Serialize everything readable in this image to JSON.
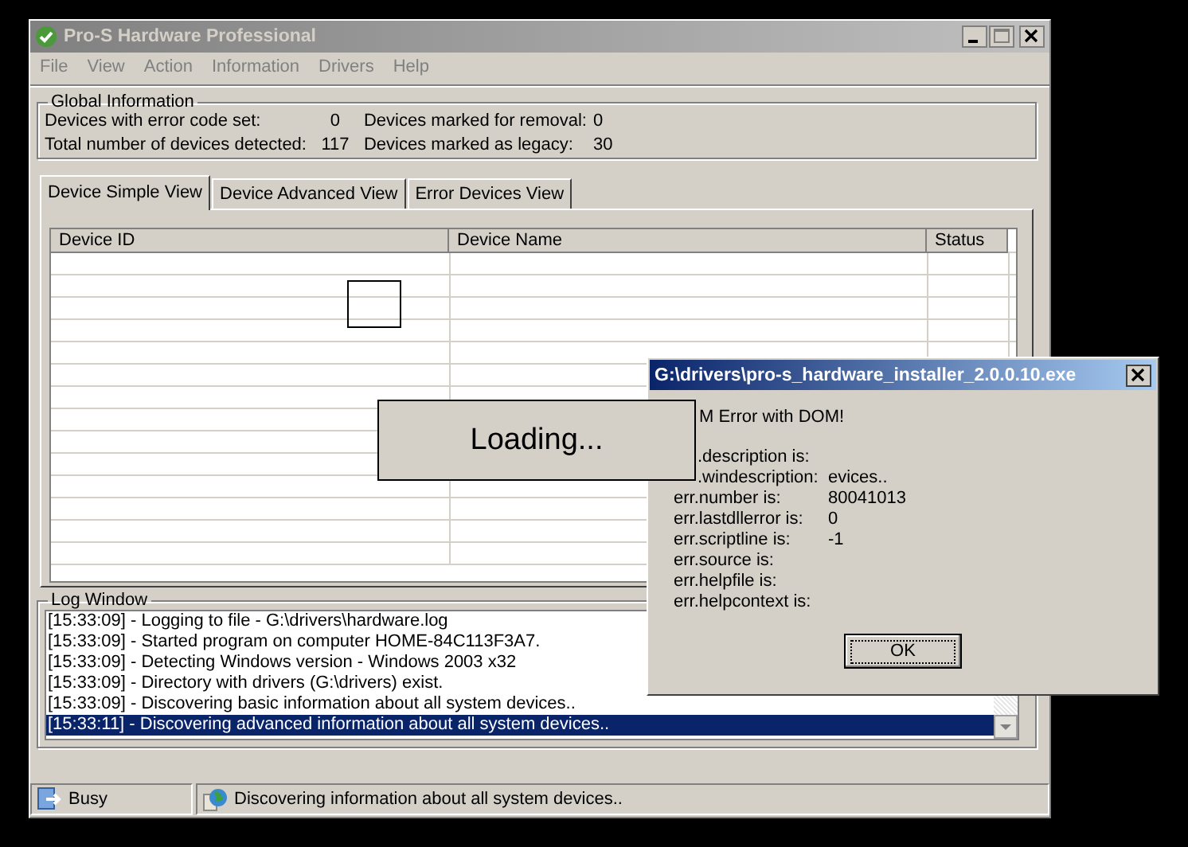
{
  "window": {
    "title": "Pro-S Hardware Professional"
  },
  "menu": [
    {
      "label": "File"
    },
    {
      "label": "View"
    },
    {
      "label": "Action"
    },
    {
      "label": "Information"
    },
    {
      "label": "Drivers"
    },
    {
      "label": "Help"
    }
  ],
  "global_info": {
    "title": "Global Information",
    "fields": [
      {
        "label": "Devices with error code set:",
        "value": "0"
      },
      {
        "label": "Devices marked for removal:",
        "value": "0"
      },
      {
        "label": "Total number of devices detected:",
        "value": "117"
      },
      {
        "label": "Devices marked as legacy:",
        "value": "30"
      }
    ]
  },
  "tabs": [
    {
      "label": "Device Simple View",
      "selected": true
    },
    {
      "label": "Device Advanced View",
      "selected": false
    },
    {
      "label": "Error Devices View",
      "selected": false
    }
  ],
  "table": {
    "columns": [
      "Device ID",
      "Device Name",
      "Status"
    ]
  },
  "loading": {
    "text": "Loading..."
  },
  "log": {
    "title": "Log Window",
    "lines": [
      {
        "text": "[15:33:09] - Logging to file - G:\\drivers\\hardware.log",
        "selected": false
      },
      {
        "text": "[15:33:09] - Started program on computer HOME-84C113F3A7.",
        "selected": false
      },
      {
        "text": "[15:33:09] - Detecting Windows version - Windows 2003 x32",
        "selected": false
      },
      {
        "text": "[15:33:09] - Directory with drivers (G:\\drivers) exist.",
        "selected": false
      },
      {
        "text": "[15:33:09] - Discovering basic information about all system devices..",
        "selected": false
      },
      {
        "text": "[15:33:11] - Discovering advanced information about all system devices..",
        "selected": true
      }
    ]
  },
  "status_bar": [
    {
      "text": "Busy",
      "kind": "busy"
    },
    {
      "text": "Discovering information about all system devices..",
      "kind": "globe"
    }
  ],
  "dialog": {
    "title": "G:\\drivers\\pro-s_hardware_installer_2.0.0.10.exe",
    "message": "M Error with DOM!",
    "fields": [
      {
        "label": ".description is:"
      },
      {
        "label": ".windescription:",
        "value": "evices.."
      },
      {
        "label": "err.number is:",
        "value": "80041013"
      },
      {
        "label": "err.lastdllerror is:",
        "value": "0"
      },
      {
        "label": "err.scriptline is:",
        "value": "-1"
      },
      {
        "label": "err.source is:"
      },
      {
        "label": "err.helpfile is:"
      },
      {
        "label": "err.helpcontext is:"
      }
    ],
    "button": "OK"
  }
}
